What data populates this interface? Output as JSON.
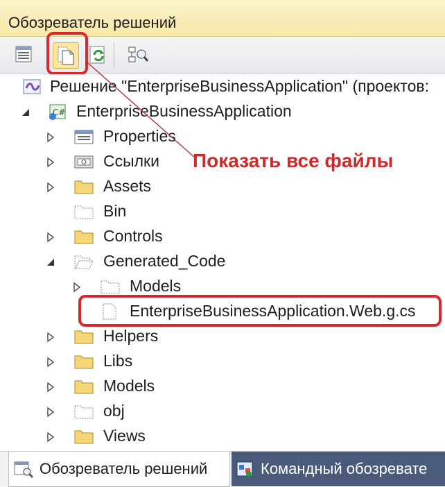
{
  "window": {
    "title": "Обозреватель решений"
  },
  "toolbar": {
    "buttons": [
      {
        "name": "properties-button",
        "icon": "properties-icon"
      },
      {
        "name": "show-all-files-button",
        "icon": "show-all-files-icon"
      },
      {
        "name": "refresh-button",
        "icon": "refresh-icon"
      },
      {
        "name": "class-diagram-button",
        "icon": "class-diagram-icon"
      }
    ]
  },
  "tree": {
    "solution": "Решение \"EnterpriseBusinessApplication\"  (проектов: ",
    "project": "EnterpriseBusinessApplication",
    "items": {
      "properties": "Properties",
      "references": "Ссылки",
      "assets": "Assets",
      "bin": "Bin",
      "controls": "Controls",
      "generated_code": "Generated_Code",
      "models_sub": "Models",
      "generated_file": "EnterpriseBusinessApplication.Web.g.cs",
      "helpers": "Helpers",
      "libs": "Libs",
      "models": "Models",
      "obj": "obj",
      "views": "Views"
    }
  },
  "annotation": {
    "text": "Показать все файлы",
    "color": "#cc2b2b"
  },
  "tabs": {
    "active": "Обозреватель решений",
    "inactive": "Командный обозревате"
  },
  "colors": {
    "highlight": "#d9282f",
    "titlebar": "#f7e7a8",
    "folder": "#f5d77a"
  }
}
